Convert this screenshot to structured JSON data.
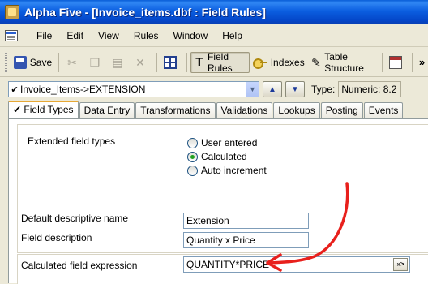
{
  "window": {
    "title": "Alpha Five - [Invoice_items.dbf : Field Rules]"
  },
  "menu": {
    "items": [
      "File",
      "Edit",
      "View",
      "Rules",
      "Window",
      "Help"
    ]
  },
  "toolbar": {
    "save_label": "Save",
    "field_rules_label": "Field Rules",
    "indexes_label": "Indexes",
    "table_structure_label": "Table Structure",
    "overflow": "»"
  },
  "field_selector": {
    "value": "Invoice_Items->EXTENSION",
    "type_label": "Type:",
    "type_value": "Numeric: 8.2"
  },
  "tabs": [
    {
      "label": "Field Types",
      "active": true
    },
    {
      "label": "Data Entry"
    },
    {
      "label": "Transformations"
    },
    {
      "label": "Validations"
    },
    {
      "label": "Lookups"
    },
    {
      "label": "Posting"
    },
    {
      "label": "Events"
    }
  ],
  "field_types": {
    "extended_label": "Extended field types",
    "options": [
      {
        "label": "User entered",
        "checked": false
      },
      {
        "label": "Calculated",
        "checked": true
      },
      {
        "label": "Auto increment",
        "checked": false
      }
    ],
    "default_name_label": "Default descriptive name",
    "default_name_value": "Extension",
    "description_label": "Field description",
    "description_value": "Quantity x Price",
    "calc_label": "Calculated field expression",
    "calc_value": "QUANTITY*PRICE",
    "expr_button": "»>"
  },
  "colors": {
    "annotation": "#e8201c",
    "title_bar": "#0b5ee0"
  }
}
